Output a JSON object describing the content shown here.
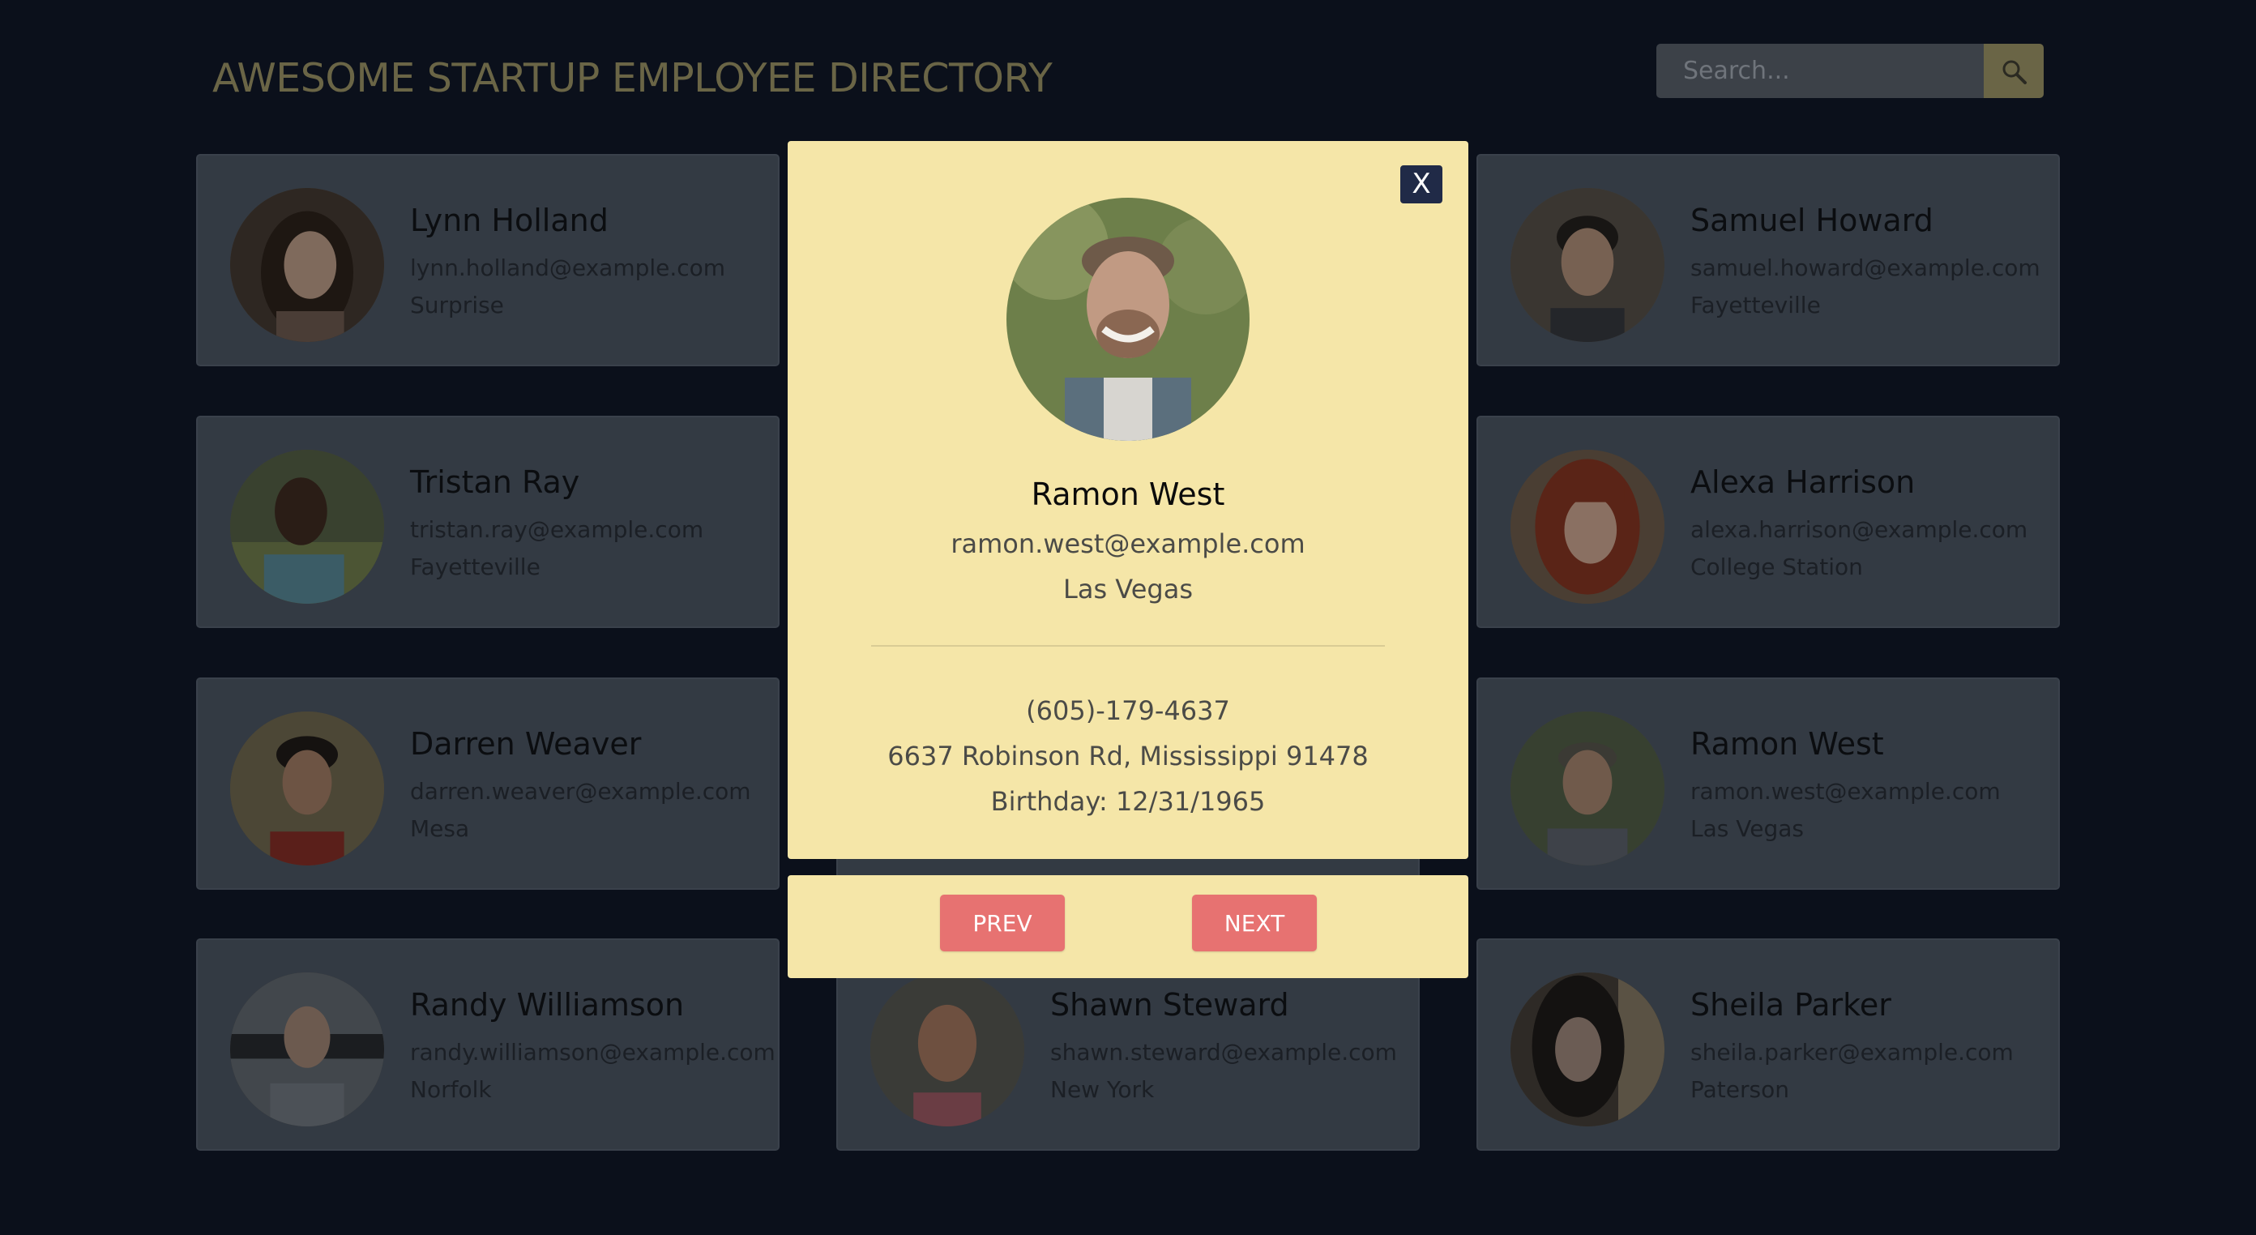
{
  "header": {
    "title": "AWESOME STARTUP EMPLOYEE DIRECTORY",
    "search_placeholder": "Search...",
    "search_icon": "search-icon"
  },
  "employees": [
    {
      "name": "Lynn Holland",
      "email": "lynn.holland@example.com",
      "city": "Surprise"
    },
    {
      "name": "Samuel Howard",
      "email": "samuel.howard@example.com",
      "city": "Fayetteville"
    },
    {
      "name": "Tristan Ray",
      "email": "tristan.ray@example.com",
      "city": "Fayetteville"
    },
    {
      "name": "Alexa Harrison",
      "email": "alexa.harrison@example.com",
      "city": "College Station"
    },
    {
      "name": "Darren Weaver",
      "email": "darren.weaver@example.com",
      "city": "Mesa"
    },
    {
      "name": "Ramon West",
      "email": "ramon.west@example.com",
      "city": "Las Vegas"
    },
    {
      "name": "Randy Williamson",
      "email": "randy.williamson@example.com",
      "city": "Norfolk"
    },
    {
      "name": "Shawn Steward",
      "email": "shawn.steward@example.com",
      "city": "New York"
    },
    {
      "name": "Sheila Parker",
      "email": "sheila.parker@example.com",
      "city": "Paterson"
    }
  ],
  "modal": {
    "close_label": "X",
    "name": "Ramon West",
    "email": "ramon.west@example.com",
    "city": "Las Vegas",
    "phone": "(605)-179-4637",
    "address": "6637 Robinson Rd, Mississippi 91478",
    "birthday": "Birthday: 12/31/1965",
    "prev_label": "PREV",
    "next_label": "NEXT"
  },
  "colors": {
    "background": "#0b101b",
    "modal": "#f5e6a8",
    "nav_button": "#e77271",
    "close_button": "#202a47",
    "card_dimmed": "#333a43"
  }
}
